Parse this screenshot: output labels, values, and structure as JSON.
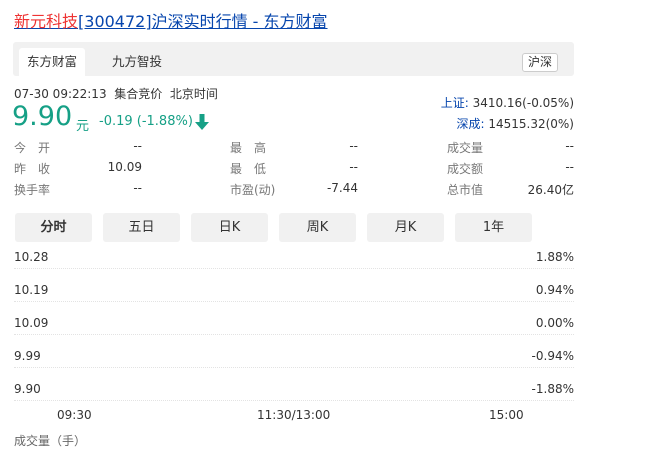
{
  "title": {
    "name": "新元科技",
    "code": "[300472]",
    "suffix": "沪深实时行情 - 东方财富"
  },
  "tabs": [
    {
      "label": "东方财富",
      "active": true
    },
    {
      "label": "九方智投",
      "active": false
    }
  ],
  "market_badge": "沪深",
  "quote": {
    "datetime": "07-30 09:22:13",
    "status": "集合竞价",
    "timezone": "北京时间",
    "price": "9.90",
    "unit": "元",
    "change": "-0.19 (-1.88%)",
    "color_down": "#16a086"
  },
  "indices": [
    {
      "label": "上证:",
      "value": "3410.16(-0.05%)"
    },
    {
      "label": "深成:",
      "value": "14515.32(0%)"
    }
  ],
  "stats": [
    [
      {
        "label": "今　开",
        "value": "--"
      },
      {
        "label": "最　高",
        "value": "--"
      },
      {
        "label": "成交量",
        "value": "--"
      }
    ],
    [
      {
        "label": "昨　收",
        "value": "10.09"
      },
      {
        "label": "最　低",
        "value": "--"
      },
      {
        "label": "成交额",
        "value": "--"
      }
    ],
    [
      {
        "label": "换手率",
        "value": "--"
      },
      {
        "label": "市盈(动)",
        "value": "-7.44"
      },
      {
        "label": "总市值",
        "value": "26.40亿"
      }
    ]
  ],
  "period_buttons": [
    "分时",
    "五日",
    "日K",
    "周K",
    "月K",
    "1年"
  ],
  "chart_data": {
    "type": "line",
    "y_prices": [
      "10.28",
      "10.19",
      "10.09",
      "9.99",
      "9.90"
    ],
    "y_percents": [
      "1.88%",
      "0.94%",
      "0.00%",
      "-0.94%",
      "-1.88%"
    ],
    "x_labels": [
      "09:30",
      "11:30/13:00",
      "15:00"
    ],
    "series": []
  },
  "volume_label": "成交量（手）"
}
